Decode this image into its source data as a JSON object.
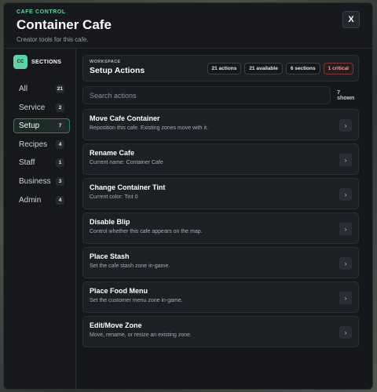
{
  "header": {
    "kicker": "CAFE CONTROL",
    "title": "Container Cafe",
    "subtitle": "Creator tools for this cafe.",
    "close_label": "X"
  },
  "sidebar": {
    "badge": "CC",
    "title": "SECTIONS",
    "items": [
      {
        "label": "All",
        "count": "21"
      },
      {
        "label": "Service",
        "count": "2"
      },
      {
        "label": "Setup",
        "count": "7"
      },
      {
        "label": "Recipes",
        "count": "4"
      },
      {
        "label": "Staff",
        "count": "1"
      },
      {
        "label": "Business",
        "count": "3"
      },
      {
        "label": "Admin",
        "count": "4"
      }
    ],
    "active": "Setup"
  },
  "workspace": {
    "kicker": "WORKSPACE",
    "title": "Setup Actions",
    "pills": {
      "actions": "21 actions",
      "available": "21 available",
      "sections": "6 sections",
      "critical": "1 critical"
    }
  },
  "search": {
    "placeholder": "Search actions",
    "shown": "7 shown"
  },
  "actions": [
    {
      "title": "Move Cafe Container",
      "desc": "Reposition this cafe. Existing zones move with it."
    },
    {
      "title": "Rename Cafe",
      "desc": "Current name: Container Cafe"
    },
    {
      "title": "Change Container Tint",
      "desc": "Current color: Tint 0"
    },
    {
      "title": "Disable Blip",
      "desc": "Control whether this cafe appears on the map."
    },
    {
      "title": "Place Stash",
      "desc": "Set the cafe stash zone in-game."
    },
    {
      "title": "Place Food Menu",
      "desc": "Set the customer menu zone in-game."
    },
    {
      "title": "Edit/Move Zone",
      "desc": "Move, rename, or resize an existing zone."
    }
  ],
  "icons": {
    "close": "close-icon",
    "chevron": "chevron-right-icon"
  },
  "colors": {
    "accent": "#5fd3a5",
    "critical": "#f2a0a0",
    "panel": "#15171b"
  }
}
